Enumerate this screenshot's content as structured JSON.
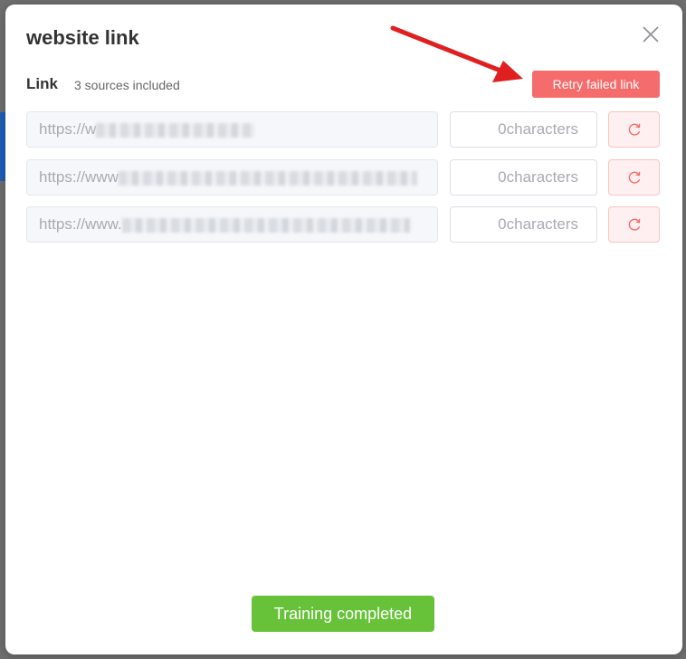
{
  "dialog": {
    "title": "website link",
    "link_label": "Link",
    "sources_text": "3 sources included",
    "retry_failed_label": "Retry failed link",
    "training_label": "Training completed"
  },
  "links": [
    {
      "url_prefix": "https://w",
      "characters": "0characters"
    },
    {
      "url_prefix": "https://www",
      "characters": "0characters"
    },
    {
      "url_prefix": "https://www.",
      "characters": "0characters"
    }
  ],
  "colors": {
    "retry_button": "#f56c6c",
    "success_button": "#67c23a",
    "annotation_arrow": "#e02020"
  },
  "icons": {
    "close": "close-icon",
    "refresh": "refresh-icon"
  }
}
